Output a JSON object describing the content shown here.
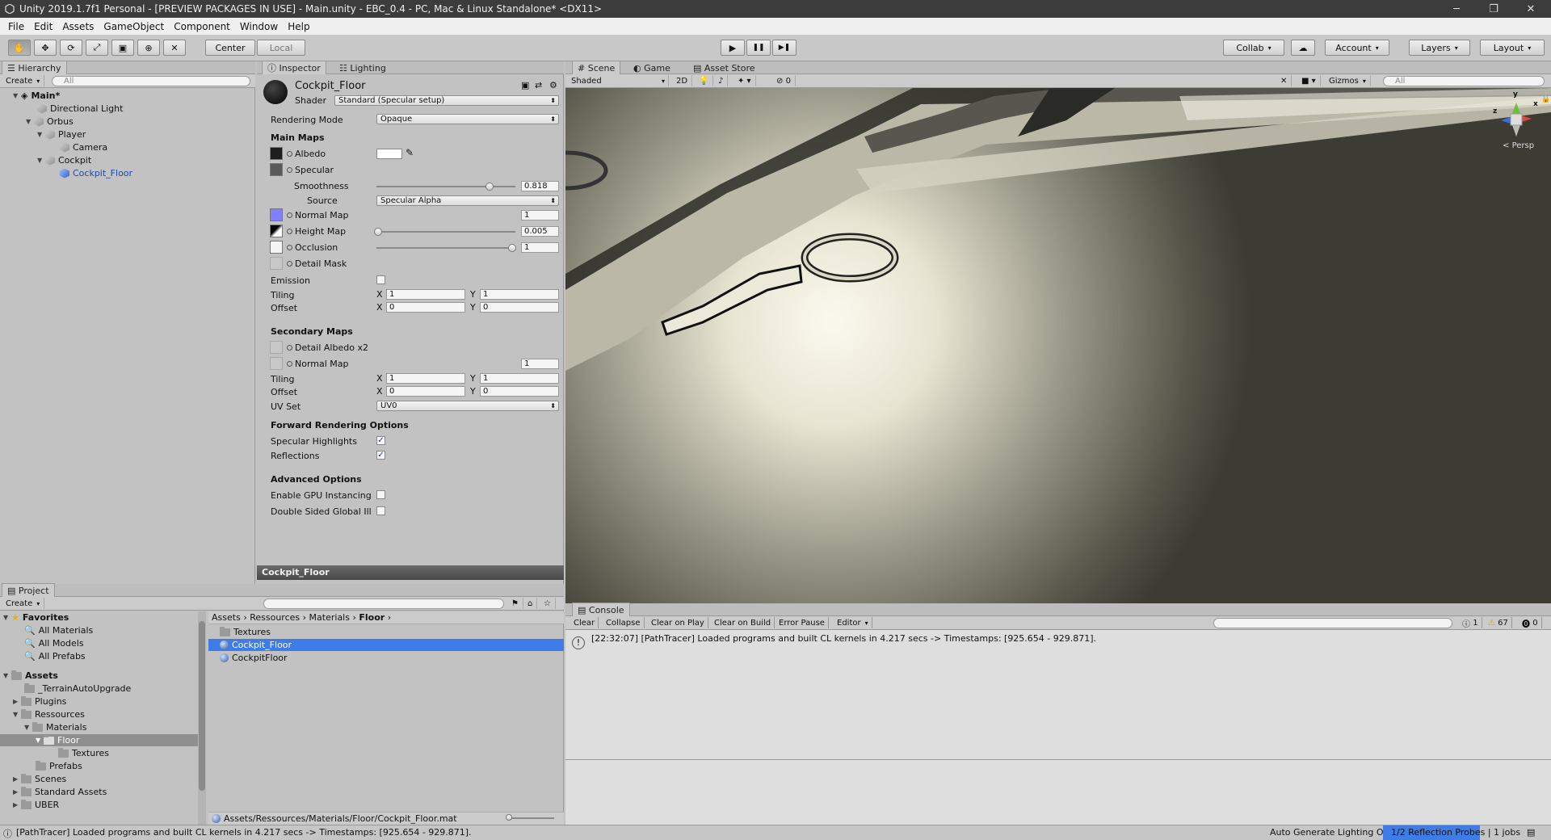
{
  "window": {
    "title": "Unity 2019.1.7f1 Personal - [PREVIEW PACKAGES IN USE] - Main.unity - EBC_0.4 - PC, Mac & Linux Standalone* <DX11>",
    "minimize": "─",
    "maximize": "❐",
    "close": "✕"
  },
  "menu": [
    "File",
    "Edit",
    "Assets",
    "GameObject",
    "Component",
    "Window",
    "Help"
  ],
  "toolbar": {
    "pivot": "Center",
    "space": "Local",
    "collab": "Collab",
    "account": "Account",
    "layers": "Layers",
    "layout": "Layout",
    "play_icon": "▶",
    "pause_icon": "❚❚",
    "step_icon": "▶❚"
  },
  "hierarchy": {
    "tab": "Hierarchy",
    "create": "Create",
    "search_placeholder": "All",
    "scene": "Main*",
    "items": [
      "Directional Light",
      "Orbus",
      "Player",
      "Camera",
      "Cockpit",
      "Cockpit_Floor"
    ]
  },
  "inspector": {
    "tab": "Inspector",
    "tab2": "Lighting",
    "object_name": "Cockpit_Floor",
    "shader_label": "Shader",
    "shader_value": "Standard (Specular setup)",
    "rendering_mode_label": "Rendering Mode",
    "rendering_mode_value": "Opaque",
    "main_maps": "Main Maps",
    "albedo": "Albedo",
    "specular": "Specular",
    "smoothness": "Smoothness",
    "smoothness_value": "0.818",
    "source": "Source",
    "source_value": "Specular Alpha",
    "normal_map": "Normal Map",
    "normal_map_value": "1",
    "height_map": "Height Map",
    "height_map_value": "0.005",
    "occlusion": "Occlusion",
    "occlusion_value": "1",
    "detail_mask": "Detail Mask",
    "emission": "Emission",
    "tiling": "Tiling",
    "offset": "Offset",
    "x_label": "X",
    "y_label": "Y",
    "tiling_x": "1",
    "tiling_y": "1",
    "offset_x": "0",
    "offset_y": "0",
    "secondary_maps": "Secondary Maps",
    "detail_albedo": "Detail Albedo x2",
    "normal_map2": "Normal Map",
    "normal_map2_value": "1",
    "tiling2": "Tiling",
    "offset2": "Offset",
    "tiling2_x": "1",
    "tiling2_y": "1",
    "offset2_x": "0",
    "offset2_y": "0",
    "uv_set": "UV Set",
    "uv_set_value": "UV0",
    "forward_rendering": "Forward Rendering Options",
    "specular_highlights": "Specular Highlights",
    "reflections": "Reflections",
    "advanced": "Advanced Options",
    "gpu_instancing": "Enable GPU Instancing",
    "double_sided": "Double Sided Global Ill",
    "preview_title": "Cockpit_Floor",
    "check": "✓"
  },
  "scene": {
    "tabs": [
      "Scene",
      "Game",
      "Asset Store"
    ],
    "shading": "Shaded",
    "mode2d": "2D",
    "fx_count": "0",
    "gizmos": "Gizmos",
    "search_placeholder": "All",
    "persp": "Persp",
    "axes": {
      "y": "y",
      "x": "x",
      "z": "z"
    }
  },
  "project": {
    "tab": "Project",
    "create": "Create",
    "favorites": "Favorites",
    "fav_items": [
      "All Materials",
      "All Models",
      "All Prefabs"
    ],
    "assets": "Assets",
    "tree": [
      "_TerrainAutoUpgrade",
      "Plugins",
      "Ressources",
      "Materials",
      "Floor",
      "Textures",
      "Prefabs",
      "Scenes",
      "Standard Assets",
      "UBER"
    ],
    "breadcrumb": [
      "Assets",
      "Ressources",
      "Materials",
      "Floor"
    ],
    "files": [
      "Textures",
      "Cockpit_Floor",
      "CockpitFloor"
    ],
    "path": "Assets/Ressources/Materials/Floor/Cockpit_Floor.mat",
    "sep": "›"
  },
  "console": {
    "tab": "Console",
    "buttons": [
      "Clear",
      "Collapse",
      "Clear on Play",
      "Clear on Build",
      "Error Pause",
      "Editor"
    ],
    "info_count": "1",
    "warn_count": "67",
    "error_count": "0",
    "message": "[22:32:07] [PathTracer] Loaded programs and built CL kernels in 4.217 secs -> Timestamps: [925.654 - 929.871]."
  },
  "status": {
    "message": "[PathTracer] Loaded programs and built CL kernels in 4.217 secs -> Timestamps: [925.654 - 929.871].",
    "auto_lighting": "Auto Generate Lighting On",
    "reflection": "1/2 Reflection Probes | 1 jobs"
  },
  "colors": {
    "selection": "#3e7de7",
    "titlebar": "#3c3c3c",
    "normal_map_swatch": "#8080ff"
  }
}
